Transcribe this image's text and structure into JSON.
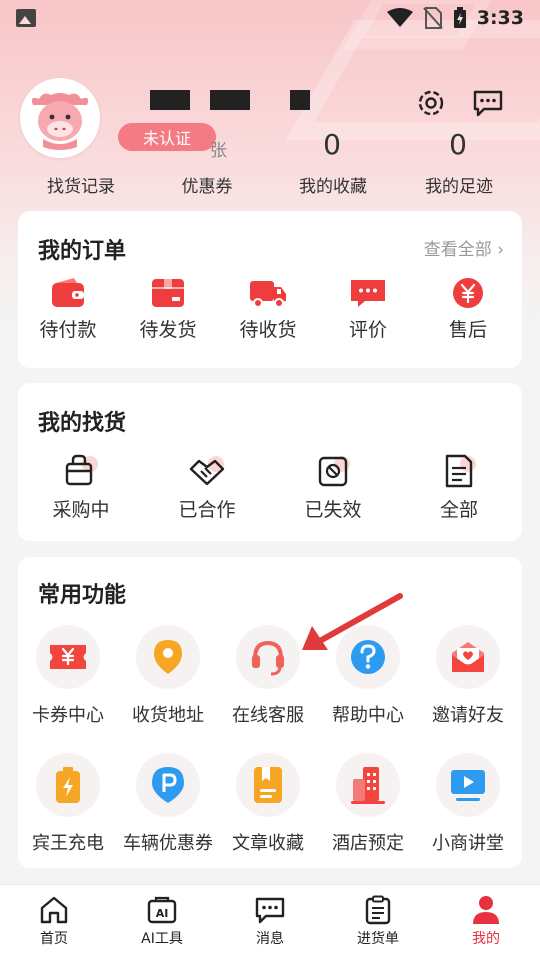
{
  "status_bar": {
    "time": "3:33"
  },
  "profile": {
    "verify_badge": "未认证",
    "stats": [
      {
        "value": "",
        "label": "找货记录"
      },
      {
        "value": "",
        "unit": "张",
        "label": "优惠券"
      },
      {
        "value": "0",
        "label": "我的收藏"
      },
      {
        "value": "0",
        "label": "我的足迹"
      }
    ]
  },
  "orders": {
    "title": "我的订单",
    "see_all": "查看全部",
    "items": [
      {
        "label": "待付款",
        "icon": "wallet-icon"
      },
      {
        "label": "待发货",
        "icon": "box-icon"
      },
      {
        "label": "待收货",
        "icon": "truck-icon"
      },
      {
        "label": "评价",
        "icon": "chat-icon"
      },
      {
        "label": "售后",
        "icon": "yen-icon"
      }
    ]
  },
  "sourcing": {
    "title": "我的找货",
    "items": [
      {
        "label": "采购中",
        "icon": "basket-icon"
      },
      {
        "label": "已合作",
        "icon": "handshake-icon"
      },
      {
        "label": "已失效",
        "icon": "expired-icon"
      },
      {
        "label": "全部",
        "icon": "document-icon"
      }
    ]
  },
  "functions": {
    "title": "常用功能",
    "row1": [
      {
        "label": "卡券中心",
        "icon": "coupon-icon"
      },
      {
        "label": "收货地址",
        "icon": "location-icon"
      },
      {
        "label": "在线客服",
        "icon": "headset-icon"
      },
      {
        "label": "帮助中心",
        "icon": "help-icon"
      },
      {
        "label": "邀请好友",
        "icon": "invite-icon"
      }
    ],
    "row2": [
      {
        "label": "宾王充电",
        "icon": "battery-icon"
      },
      {
        "label": "车辆优惠券",
        "icon": "parking-icon"
      },
      {
        "label": "文章收藏",
        "icon": "bookmark-icon"
      },
      {
        "label": "酒店预定",
        "icon": "hotel-icon"
      },
      {
        "label": "小商讲堂",
        "icon": "video-icon"
      }
    ]
  },
  "tabbar": {
    "items": [
      {
        "label": "首页",
        "icon": "home-icon"
      },
      {
        "label": "AI工具",
        "icon": "ai-icon"
      },
      {
        "label": "消息",
        "icon": "message-icon"
      },
      {
        "label": "进货单",
        "icon": "clipboard-icon"
      },
      {
        "label": "我的",
        "icon": "user-icon",
        "active": true
      }
    ]
  },
  "colors": {
    "accent": "#e8313e",
    "badge": "#f47a83"
  }
}
